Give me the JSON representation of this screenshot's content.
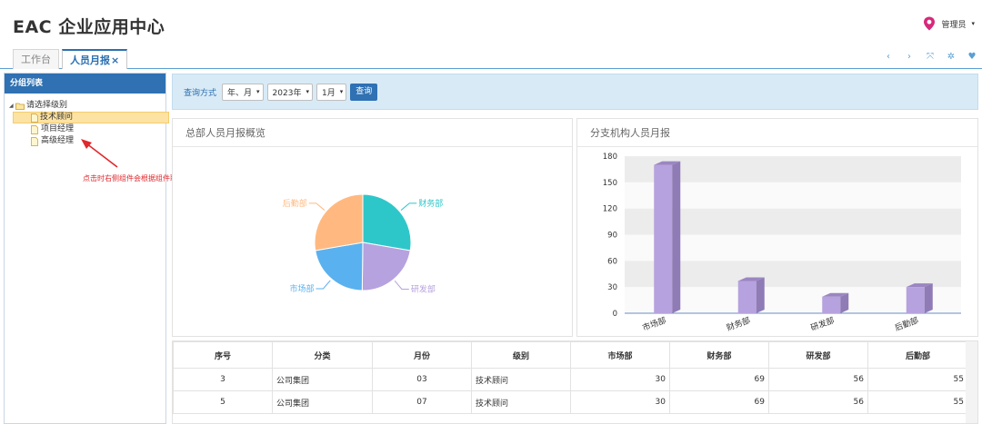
{
  "app": {
    "title": "EAC 企业应用中心",
    "user": "管理员",
    "user_caret": "▾"
  },
  "tabs": [
    {
      "label": "工作台"
    },
    {
      "label": "人员月报",
      "close": "×"
    }
  ],
  "toolbar_icons": [
    "chevron-left-icon",
    "chevron-right-icon",
    "fullscreen-icon",
    "gear-icon",
    "heart-icon"
  ],
  "toolbar_glyphs": {
    "prev": "‹",
    "next": "›",
    "full": "⤧",
    "gear": "✲",
    "heart": "♥"
  },
  "sidebar": {
    "title": "分组列表",
    "root": "请选择级别",
    "items": [
      {
        "label": "技术顾问",
        "selected": true
      },
      {
        "label": "项目经理",
        "selected": false
      },
      {
        "label": "高级经理",
        "selected": false
      }
    ],
    "annotation": "点击时右侧组件会根据组件联动信息进行刷新"
  },
  "query": {
    "label": "查询方式",
    "mode": "年、月",
    "year": "2023年",
    "month": "1月",
    "button": "查询",
    "chev": "▾"
  },
  "pie_panel": {
    "title": "总部人员月报概览"
  },
  "bar_panel": {
    "title": "分支机构人员月报"
  },
  "chart_data": [
    {
      "type": "pie",
      "categories": [
        "财务部",
        "研发部",
        "市场部",
        "后勤部"
      ],
      "values": [
        69,
        56,
        55,
        69
      ],
      "colors": [
        "#2ec7c9",
        "#b6a2de",
        "#5ab1ef",
        "#ffb980"
      ]
    },
    {
      "type": "bar",
      "categories": [
        "市场部",
        "财务部",
        "研发部",
        "后勤部"
      ],
      "values": [
        170,
        37,
        19,
        30
      ],
      "ylim": [
        0,
        180
      ],
      "yticks": [
        0,
        30,
        60,
        90,
        120,
        150,
        180
      ],
      "color": "#b6a2de",
      "grid": true
    }
  ],
  "table": {
    "headers": [
      "序号",
      "分类",
      "月份",
      "级别",
      "市场部",
      "财务部",
      "研发部",
      "后勤部"
    ],
    "rows": [
      [
        "3",
        "公司集团",
        "03",
        "技术顾问",
        "30",
        "69",
        "56",
        "55"
      ],
      [
        "5",
        "公司集团",
        "07",
        "技术顾问",
        "30",
        "69",
        "56",
        "55"
      ]
    ]
  }
}
